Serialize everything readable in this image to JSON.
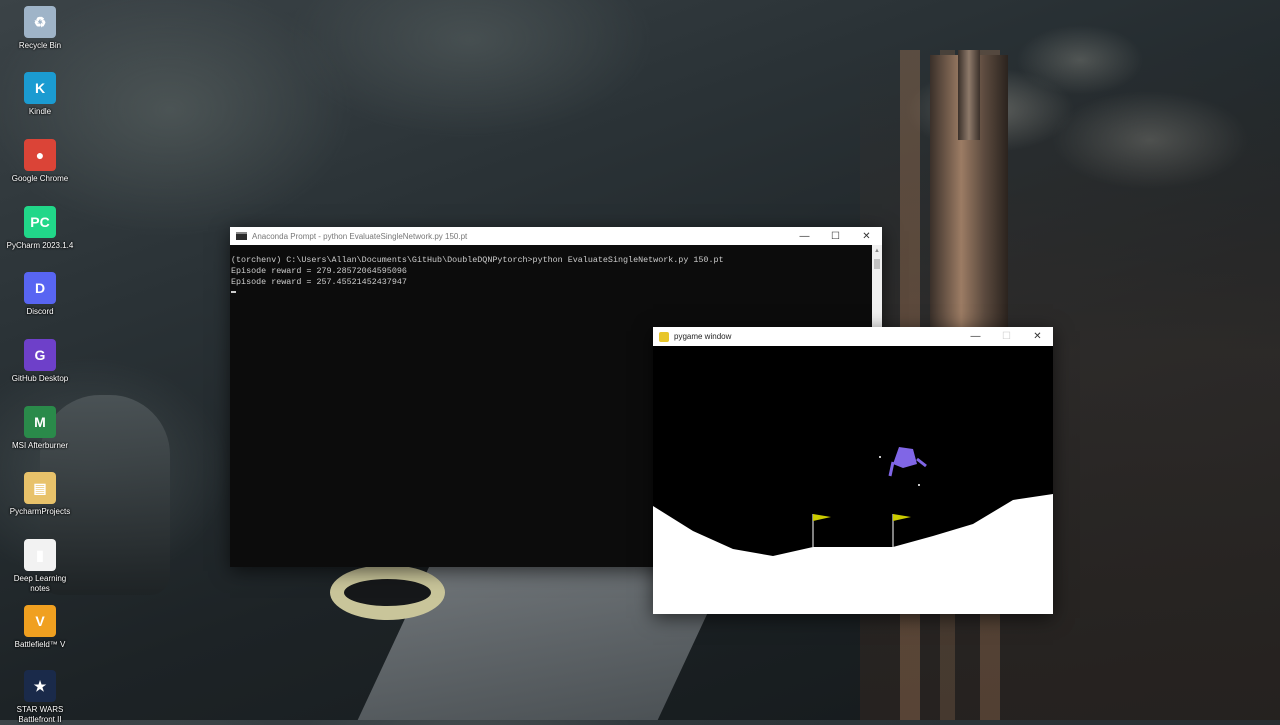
{
  "desktop": {
    "icons": [
      {
        "label": "Recycle Bin",
        "color": "#9fb4c8",
        "glyph": "♻"
      },
      {
        "label": "Kindle",
        "color": "#1b9bd1",
        "glyph": "K"
      },
      {
        "label": "Google Chrome",
        "color": "#db4437",
        "glyph": "●"
      },
      {
        "label": "PyCharm 2023.1.4",
        "color": "#21d789",
        "glyph": "PC"
      },
      {
        "label": "Discord",
        "color": "#5865f2",
        "glyph": "D"
      },
      {
        "label": "GitHub Desktop",
        "color": "#6e40c9",
        "glyph": "G"
      },
      {
        "label": "MSI Afterburner",
        "color": "#2a8a4a",
        "glyph": "M"
      },
      {
        "label": "PycharmProjects",
        "color": "#e8c26a",
        "glyph": "▤"
      },
      {
        "label": "Deep Learning notes",
        "color": "#f2f2f2",
        "glyph": "▮"
      },
      {
        "label": "Battlefield™ V",
        "color": "#f0a020",
        "glyph": "V"
      },
      {
        "label": "STAR WARS Battlefront II",
        "color": "#1a2a4a",
        "glyph": "★"
      }
    ]
  },
  "console": {
    "title": "Anaconda Prompt - python  EvaluateSingleNetwork.py 150.pt",
    "lines": [
      "(torchenv) C:\\Users\\Allan\\Documents\\GitHub\\DoubleDQNPytorch>python EvaluateSingleNetwork.py 150.pt",
      "Episode reward = 279.28572064595096",
      "Episode reward = 257.45521452437947"
    ]
  },
  "pygame": {
    "title": "pygame window",
    "lander_color": "#8066e6",
    "flag_color": "#cccc00",
    "ground_color": "#ffffff"
  },
  "controls": {
    "minimize": "—",
    "maximize": "☐",
    "close": "✕"
  }
}
